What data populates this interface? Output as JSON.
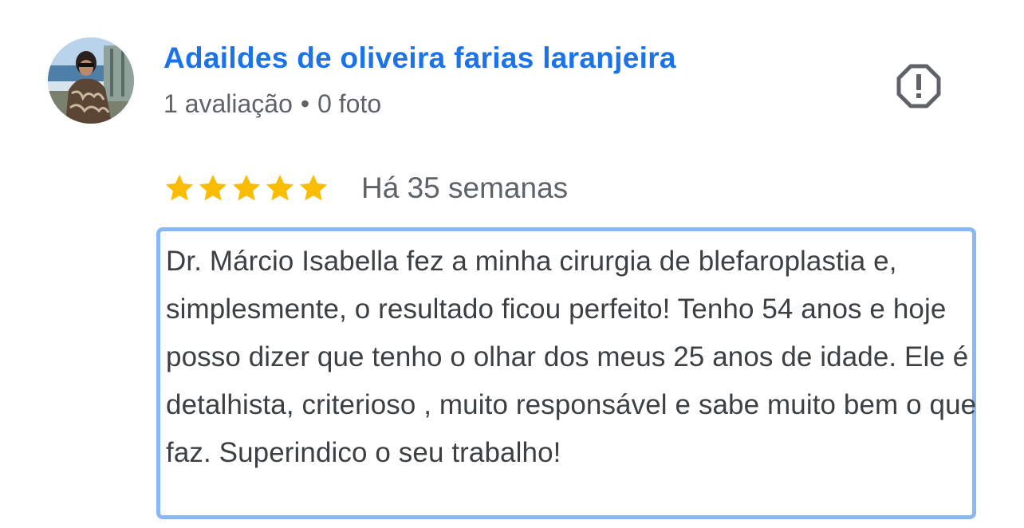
{
  "review": {
    "author_name": "Adaildes de oliveira farias laranjeira",
    "reviews_count": "1 avaliação",
    "separator": "•",
    "photos_count": "0 foto",
    "rating": 5,
    "rating_max": 5,
    "time_ago": "Há 35 semanas",
    "text": "Dr. Márcio Isabella fez a minha cirurgia de blefaroplastia e, simplesmente, o resultado ficou perfeito! Tenho 54 anos e hoje posso dizer que tenho o olhar dos meus 25 anos de idade. Ele é detalhista, criterioso , muito responsável e sabe muito bem o que faz. Superindico o seu trabalho!"
  },
  "icons": {
    "report": "report-flag-icon",
    "star": "star-icon"
  },
  "colors": {
    "author_name": "#1a73e8",
    "star": "#fbbc04",
    "muted_text": "#5f6368",
    "highlight_border": "#8ab8f5"
  }
}
